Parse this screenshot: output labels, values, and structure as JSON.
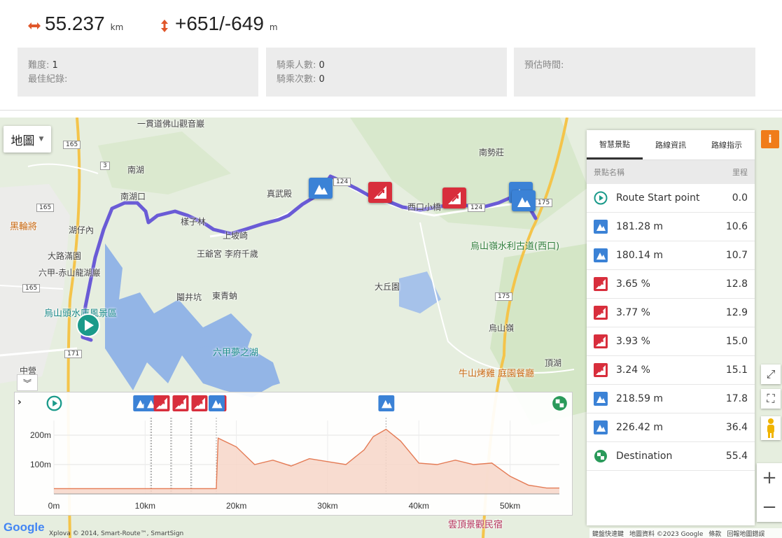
{
  "stats": {
    "distance": "55.237",
    "distance_unit": "km",
    "climb": "+651/-649",
    "climb_unit": "m"
  },
  "info_boxes": [
    {
      "rows": [
        {
          "label": "難度:",
          "value": "1"
        },
        {
          "label": "最佳紀錄:",
          "value": ""
        }
      ]
    },
    {
      "rows": [
        {
          "label": "騎乘人數:",
          "value": "0"
        },
        {
          "label": "騎乘次數:",
          "value": "0"
        }
      ]
    },
    {
      "rows": [
        {
          "label": "預估時間:",
          "value": ""
        }
      ]
    }
  ],
  "map": {
    "type_button": "地圖",
    "labels": [
      "一貫道佛山觀音巖",
      "南湖",
      "南湖口",
      "真武殿",
      "西口小橋",
      "南勢莊",
      "湖仔內",
      "黑輪將",
      "大路滿園",
      "六甲-赤山龍湖巖",
      "烏山頭水庫風景區",
      "王爺宮 李府千歲",
      "東青蚋",
      "大丘園",
      "烏山嶺水利古道(西口)",
      "烏山嶺",
      "六甲夢之湖",
      "牛山烤雞 庭園餐廳",
      "頂湖",
      "中營",
      "雲頂景觀民宿",
      "上坡崎",
      "樣子林",
      "鬮井坑"
    ],
    "roads": [
      "165",
      "3",
      "124",
      "171",
      "175"
    ],
    "attribution": "Xplova © 2014, Smart-Route™, SmartSign",
    "attribution_right": [
      "鍵盤快速鍵",
      "地圖資料 ©2023 Google",
      "條款",
      "回報地圖錯誤"
    ],
    "google": "Google"
  },
  "panel": {
    "tabs": [
      "智慧景點",
      "路線資訊",
      "路線指示"
    ],
    "header_name": "景點名稱",
    "header_dist": "里程",
    "rows": [
      {
        "type": "start",
        "name": "Route Start point",
        "dist": "0.0"
      },
      {
        "type": "peak",
        "name": "181.28 m",
        "dist": "10.6"
      },
      {
        "type": "peak",
        "name": "180.14 m",
        "dist": "10.7"
      },
      {
        "type": "climb",
        "name": "3.65 %",
        "dist": "12.8"
      },
      {
        "type": "climb",
        "name": "3.77 %",
        "dist": "12.9"
      },
      {
        "type": "climb",
        "name": "3.93 %",
        "dist": "15.0"
      },
      {
        "type": "climb",
        "name": "3.24 %",
        "dist": "15.1"
      },
      {
        "type": "peak",
        "name": "218.59 m",
        "dist": "17.8"
      },
      {
        "type": "peak",
        "name": "226.42 m",
        "dist": "36.4"
      },
      {
        "type": "finish",
        "name": "Destination",
        "dist": "55.4"
      }
    ]
  },
  "chart_data": {
    "type": "area",
    "title": "",
    "xlabel": "",
    "ylabel": "",
    "x_ticks": [
      "0m",
      "10km",
      "20km",
      "30km",
      "40km",
      "50km"
    ],
    "y_ticks": [
      "100m",
      "200m"
    ],
    "xlim": [
      0,
      55.4
    ],
    "ylim": [
      0,
      250
    ],
    "x": [
      0,
      2,
      4,
      6,
      8,
      10,
      12,
      14,
      16,
      17.8,
      18,
      20,
      22,
      24,
      26,
      28,
      30,
      32,
      34,
      35,
      36.4,
      38,
      40,
      42,
      44,
      46,
      48,
      50,
      52,
      54,
      55.4
    ],
    "values": [
      18,
      18,
      18,
      18,
      18,
      18,
      18,
      18,
      18,
      18,
      190,
      160,
      100,
      115,
      95,
      120,
      110,
      100,
      150,
      195,
      220,
      180,
      105,
      100,
      115,
      100,
      105,
      60,
      30,
      20,
      20
    ],
    "markers": [
      {
        "km": 0.0,
        "type": "start"
      },
      {
        "km": 10.6,
        "type": "peak"
      },
      {
        "km": 10.7,
        "type": "peak"
      },
      {
        "km": 12.8,
        "type": "climb"
      },
      {
        "km": 12.9,
        "type": "climb"
      },
      {
        "km": 15.0,
        "type": "climb"
      },
      {
        "km": 15.1,
        "type": "climb"
      },
      {
        "km": 17.8,
        "type": "peak"
      },
      {
        "km": 36.4,
        "type": "peak"
      },
      {
        "km": 55.4,
        "type": "finish"
      }
    ]
  },
  "colors": {
    "route": "#6a5bd6",
    "elevation_line": "#e47b55",
    "elevation_fill": "#f7d6c8",
    "peak_icon": "#3b82d6",
    "climb_icon": "#d82e3c",
    "start_icon": "#1a9a8a",
    "accent": "#f07c1a"
  }
}
